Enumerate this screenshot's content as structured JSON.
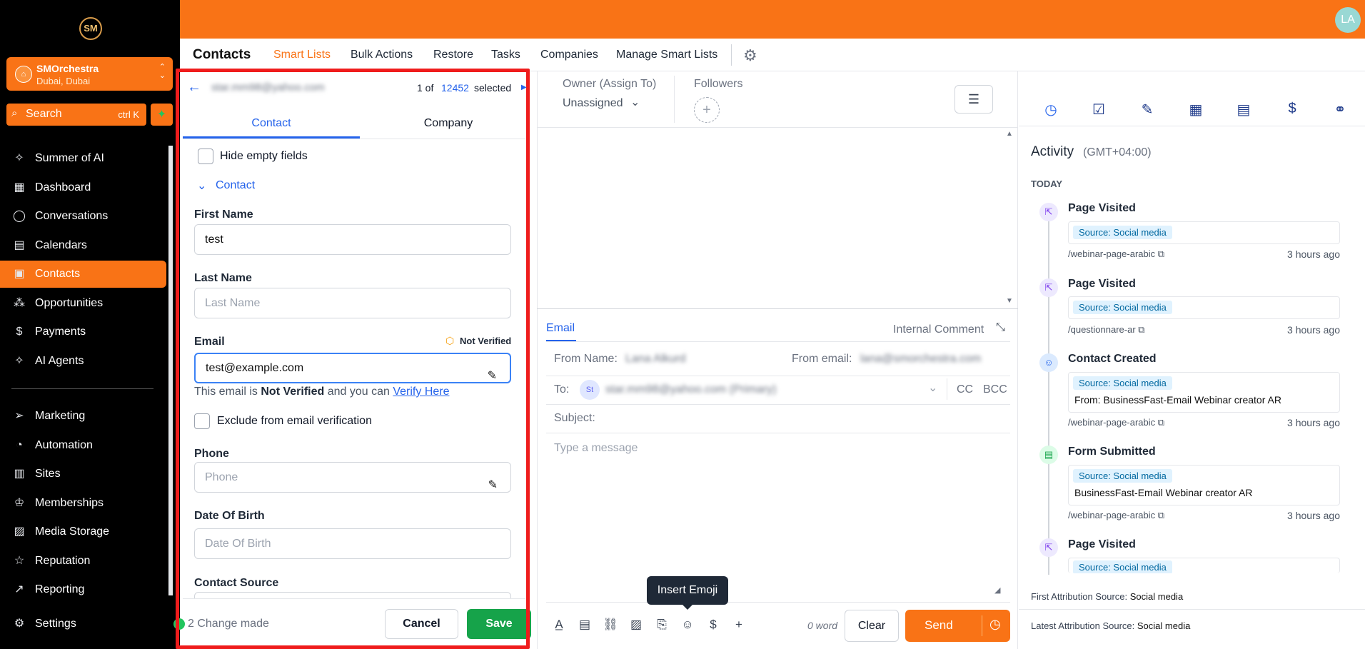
{
  "sidebar": {
    "logo": "SM",
    "org_name": "SMOrchestra",
    "org_location": "Dubai, Dubai",
    "search_label": "Search",
    "search_shortcut": "ctrl K",
    "items": [
      {
        "label": "Summer of AI",
        "icon": "sparkle-icon"
      },
      {
        "label": "Dashboard",
        "icon": "dashboard-icon"
      },
      {
        "label": "Conversations",
        "icon": "chat-icon"
      },
      {
        "label": "Calendars",
        "icon": "calendar-icon"
      },
      {
        "label": "Contacts",
        "icon": "contacts-icon"
      },
      {
        "label": "Opportunities",
        "icon": "opportunities-icon"
      },
      {
        "label": "Payments",
        "icon": "payments-icon"
      },
      {
        "label": "AI Agents",
        "icon": "sparkle-icon"
      },
      {
        "label": "Marketing",
        "icon": "send-icon"
      },
      {
        "label": "Automation",
        "icon": "automation-icon"
      },
      {
        "label": "Sites",
        "icon": "sites-icon"
      },
      {
        "label": "Memberships",
        "icon": "memberships-icon"
      },
      {
        "label": "Media Storage",
        "icon": "media-icon"
      },
      {
        "label": "Reputation",
        "icon": "star-icon"
      },
      {
        "label": "Reporting",
        "icon": "chart-icon"
      },
      {
        "label": "Settings",
        "icon": "gear-icon"
      }
    ]
  },
  "topbar": {
    "user_initials": "LA",
    "accent": "#f97316"
  },
  "subnav": {
    "title": "Contacts",
    "tabs": [
      "Smart Lists",
      "Bulk Actions",
      "Restore",
      "Tasks",
      "Companies",
      "Manage Smart Lists"
    ]
  },
  "contact_panel": {
    "email_header": "star.mm98@yahoo.com",
    "pager_prefix": "1 of",
    "pager_total": "12452",
    "pager_suffix": "selected",
    "tab_contact": "Contact",
    "tab_company": "Company",
    "hide_empty": "Hide empty fields",
    "section": "Contact",
    "first_name_label": "First Name",
    "first_name_value": "test",
    "last_name_label": "Last Name",
    "last_name_placeholder": "Last Name",
    "email_label": "Email",
    "not_verified": "Not Verified",
    "email_value": "test@example.com",
    "verify_text_1": "This email is",
    "verify_text_2": "Not Verified",
    "verify_text_3": "and you can",
    "verify_link": "Verify Here",
    "exclude_label": "Exclude from email verification",
    "phone_label": "Phone",
    "phone_placeholder": "Phone",
    "dob_label": "Date Of Birth",
    "dob_placeholder": "Date Of Birth",
    "source_label": "Contact Source",
    "changes": "2 Change made",
    "cancel": "Cancel",
    "save": "Save"
  },
  "composer": {
    "owner_label": "Owner (Assign To)",
    "owner_value": "Unassigned",
    "followers_label": "Followers",
    "tab_email": "Email",
    "internal_comment": "Internal Comment",
    "from_name_label": "From Name:",
    "from_name_value": "Lana Alkurd",
    "from_email_label": "From email:",
    "from_email_value": "lana@smorchestra.com",
    "to_label": "To:",
    "to_initials": "St",
    "to_value": "star.mm98@yahoo.com (Primary)",
    "cc": "CC",
    "bcc": "BCC",
    "subject_label": "Subject:",
    "message_placeholder": "Type a message",
    "tooltip": "Insert Emoji",
    "word_count": "0 word",
    "clear": "Clear",
    "send": "Send"
  },
  "activity": {
    "title": "Activity",
    "timezone": "(GMT+04:00)",
    "today": "TODAY",
    "items": [
      {
        "title": "Page Visited",
        "source": "Source: Social media",
        "from": "",
        "url": "/webinar-page-arabic",
        "time": "3 hours ago"
      },
      {
        "title": "Page Visited",
        "source": "Source: Social media",
        "from": "",
        "url": "/questionnare-ar",
        "time": "3 hours ago"
      },
      {
        "title": "Contact Created",
        "source": "Source: Social media",
        "from": "From: BusinessFast-Email Webinar creator AR",
        "url": "/webinar-page-arabic",
        "time": "3 hours ago"
      },
      {
        "title": "Form Submitted",
        "source": "Source: Social media",
        "from": "BusinessFast-Email Webinar creator AR",
        "url": "/webinar-page-arabic",
        "time": "3 hours ago"
      },
      {
        "title": "Page Visited",
        "source": "Source: Social media",
        "from": "",
        "url": "",
        "time": ""
      }
    ],
    "first_attr_label": "First Attribution Source:",
    "first_attr_value": "Social media",
    "latest_attr_label": "Latest Attribution Source:",
    "latest_attr_value": "Social media"
  }
}
